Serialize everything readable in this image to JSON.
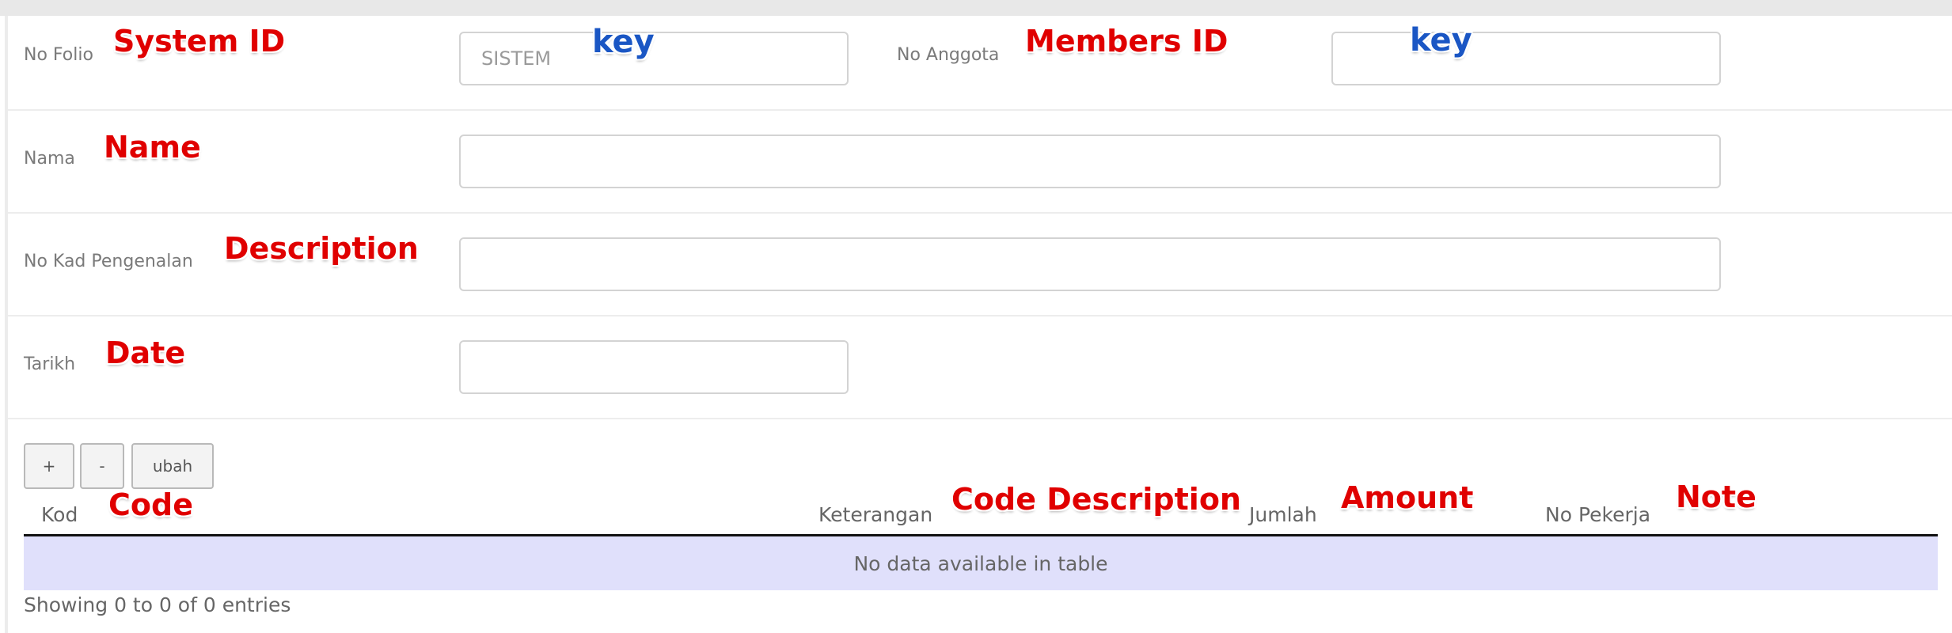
{
  "form": {
    "no_folio": {
      "label": "No Folio",
      "placeholder": "SISTEM",
      "value": "",
      "annotation": "System ID",
      "key_note": "key"
    },
    "no_anggota": {
      "label": "No Anggota",
      "placeholder": "",
      "value": "",
      "annotation": "Members ID",
      "key_note": "key"
    },
    "nama": {
      "label": "Nama",
      "value": "",
      "annotation": "Name"
    },
    "no_kad": {
      "label": "No Kad Pengenalan",
      "value": "",
      "annotation": "Description"
    },
    "tarikh": {
      "label": "Tarikh",
      "value": "",
      "annotation": "Date"
    }
  },
  "toolbar": {
    "add_label": "+",
    "remove_label": "-",
    "edit_label": "ubah"
  },
  "table": {
    "columns": [
      {
        "label": "Kod",
        "annotation": "Code"
      },
      {
        "label": "Keterangan",
        "annotation": "Code Description"
      },
      {
        "label": "Jumlah",
        "annotation": "Amount"
      },
      {
        "label": "No Pekerja",
        "annotation": "Note"
      }
    ],
    "rows": [],
    "empty_text": "No data available in table",
    "info": "Showing 0 to 0 of 0 entries"
  },
  "colors": {
    "annotation_red": "#e00000",
    "annotation_blue": "#1a56c4",
    "empty_row_bg": "#e0e0fb"
  }
}
